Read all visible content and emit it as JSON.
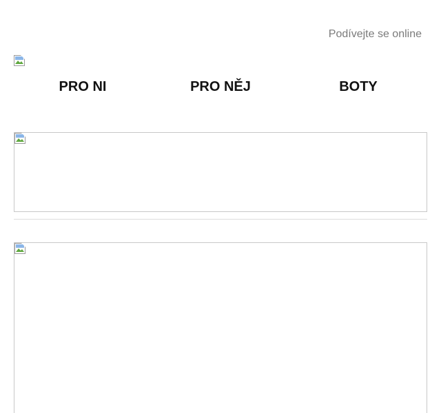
{
  "header": {
    "view_online_label": "Podívejte se online",
    "logo_icon": "broken-image-icon"
  },
  "nav": {
    "items": [
      {
        "label": "PRO NI"
      },
      {
        "label": "PRO NĚJ"
      },
      {
        "label": "BOTY"
      }
    ]
  },
  "banners": [
    {
      "icon": "broken-image-icon"
    },
    {
      "icon": "broken-image-icon"
    }
  ],
  "colors": {
    "view_online_text": "#7a7a7a",
    "nav_text": "#111111",
    "banner_border": "#c8c8c8",
    "divider": "#dddddd"
  }
}
